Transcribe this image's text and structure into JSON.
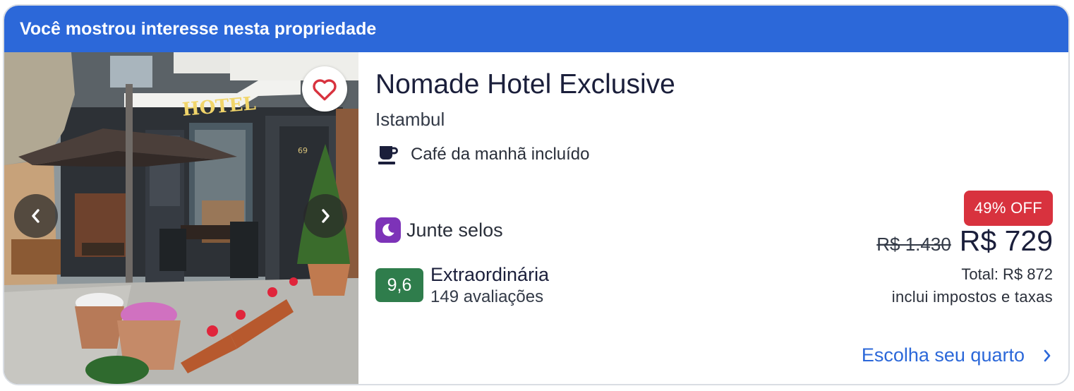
{
  "banner": {
    "text": "Você mostrou interesse nesta propriedade"
  },
  "photo": {
    "sign_text": "HOTEL",
    "door_number": "69",
    "favorite_icon": "heart-outline-icon",
    "prev_icon": "chevron-left-icon",
    "next_icon": "chevron-right-icon"
  },
  "hotel": {
    "name": "Nomade Hotel Exclusive",
    "city": "Istambul",
    "amenity": {
      "icon": "coffee-cup-icon",
      "label": "Café da manhã incluído"
    },
    "stamps": {
      "icon": "moon-icon",
      "label": "Junte selos"
    },
    "rating": {
      "score": "9,6",
      "label": "Extraordinária",
      "count": "149 avaliações"
    }
  },
  "price": {
    "discount": "49% OFF",
    "old": "R$ 1.430",
    "current": "R$ 729",
    "total": "Total: R$ 872",
    "taxes": "inclui impostos e taxas"
  },
  "cta": {
    "label": "Escolha seu quarto",
    "icon": "chevron-right-icon"
  },
  "colors": {
    "banner": "#2c68d9",
    "discount": "#d8323e",
    "rating": "#2f7d4c",
    "stamps": "#7d33b8",
    "link": "#2c68d9"
  }
}
